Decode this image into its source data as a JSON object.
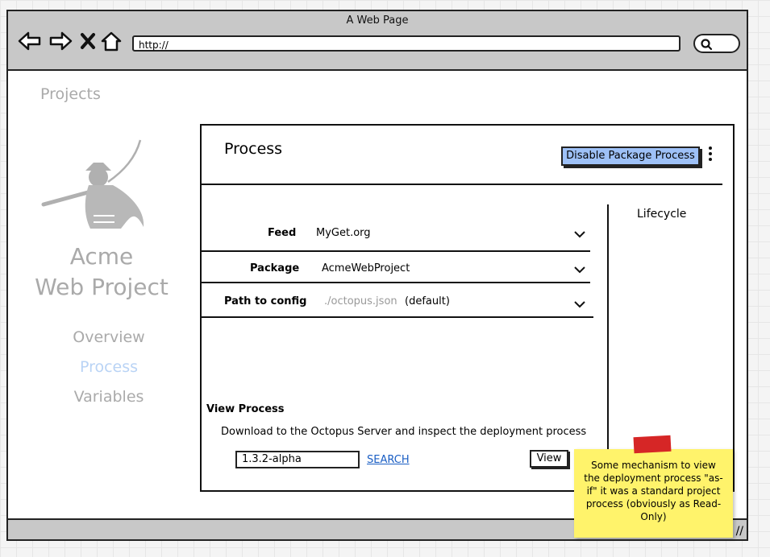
{
  "browser": {
    "title": "A Web Page",
    "url": "http://"
  },
  "sidebar": {
    "projects_link": "Projects",
    "project_name_line1": "Acme",
    "project_name_line2": "Web Project",
    "nav": [
      {
        "label": "Overview",
        "active": false
      },
      {
        "label": "Process",
        "active": true
      },
      {
        "label": "Variables",
        "active": false
      }
    ]
  },
  "panel": {
    "title": "Process",
    "primary_button": "Disable Package Process",
    "lifecycle_heading": "Lifecycle",
    "fields": [
      {
        "label": "Feed",
        "value": "MyGet.org"
      },
      {
        "label": "Package",
        "value": "AcmeWebProject"
      },
      {
        "label": "Path to config",
        "placeholder": "./octopus.json",
        "suffix": "(default)"
      }
    ],
    "view_process": {
      "heading": "View Process",
      "description": "Download to the Octopus Server and inspect the deployment process",
      "version_value": "1.3.2-alpha",
      "search_label": "SEARCH",
      "view_button": "View"
    }
  },
  "sticky_note": {
    "text": "Some mechanism to view the deployment process \"as-if\" it was a standard project process (obviously as Read-Only)"
  },
  "colors": {
    "primary_button": "#9ec1f7",
    "active_nav": "#b9d3f5",
    "muted_text": "#aaaaaa",
    "link": "#1a5ec4",
    "sticky": "#fff36b",
    "tape": "#d62626"
  }
}
